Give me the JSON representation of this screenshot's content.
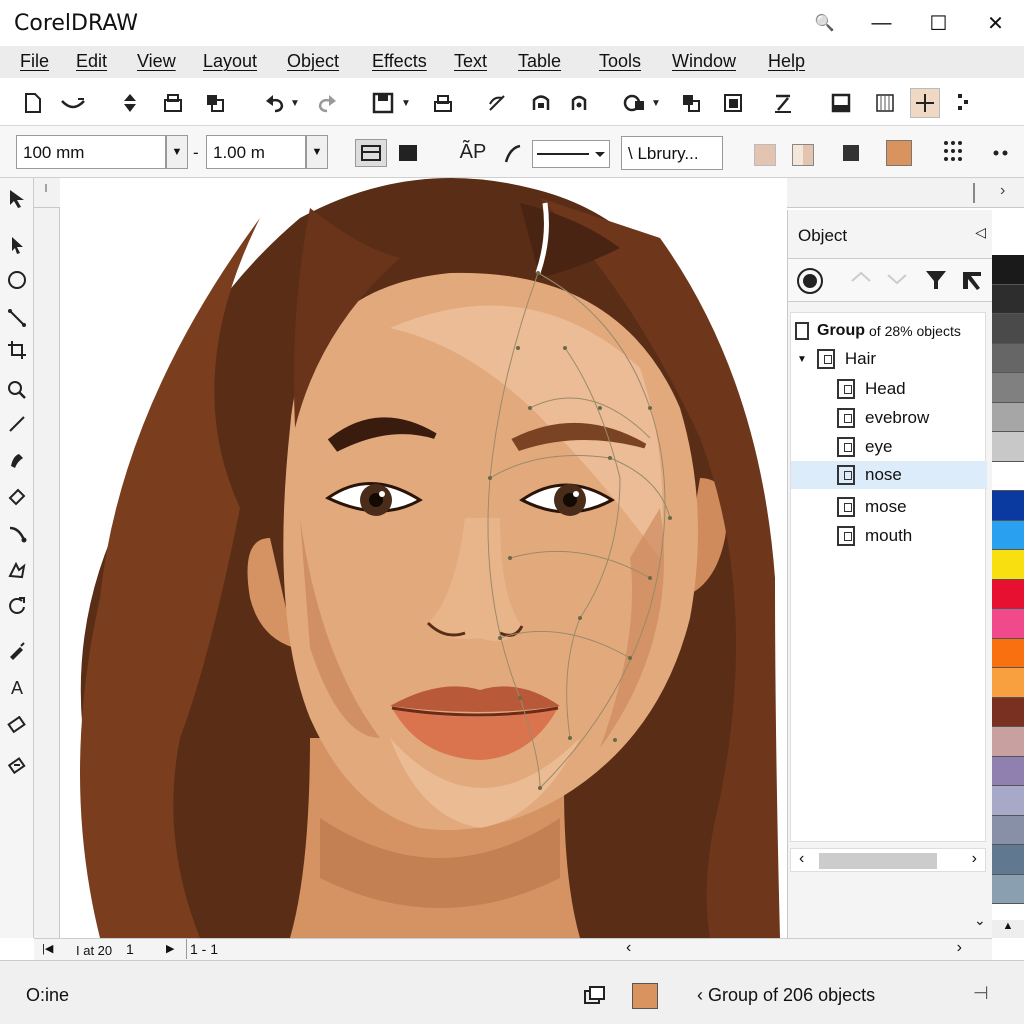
{
  "app": {
    "title": "CorelDRAW"
  },
  "window_controls": {
    "search": "🔍",
    "minimize": "—",
    "maximize": "☐",
    "close": "✕"
  },
  "menu": [
    "File",
    "Edit",
    "View",
    "Layout",
    "Object",
    "Effects",
    "Text",
    "Table",
    "Tools",
    "Window",
    "Help"
  ],
  "property_bar": {
    "width_value": "100 mm",
    "separator": "-",
    "height_value": "1.00 m",
    "library_label": "\\ Lbrury..."
  },
  "docker": {
    "title": "Object",
    "items": [
      {
        "label": "Group",
        "suffix": "of 28% objects",
        "level": 0
      },
      {
        "label": "Hair",
        "level": 1,
        "expanded": true
      },
      {
        "label": "Head",
        "level": 2
      },
      {
        "label": "evebrow",
        "level": 2
      },
      {
        "label": "eye",
        "level": 2
      },
      {
        "label": "nose",
        "level": 2,
        "selected": true
      },
      {
        "label": "mose",
        "level": 2
      },
      {
        "label": "mouth",
        "level": 2
      }
    ]
  },
  "page_nav": {
    "page_info": "I at 20",
    "page_number": "1",
    "page_range": "1 - 1"
  },
  "status": {
    "left_text": "O:ine",
    "selection_text": "Group of 206 objects",
    "fill_color": "#d9935f"
  },
  "colors": {
    "accent_fill": "#d9935f",
    "selected_row": "#dcecfb",
    "palette": [
      "#1a1a1a",
      "#2d2d2d",
      "#4a4a4a",
      "#666666",
      "#808080",
      "#a6a6a6",
      "#c8c8c8",
      "#ffffff",
      "#0a3aa0",
      "#2aa0f0",
      "#f8e010",
      "#e81030",
      "#f04a8c",
      "#f87010",
      "#f8a040",
      "#7a3020",
      "#c8a0a0",
      "#9080b0",
      "#a8a8c8",
      "#8890a8",
      "#607890",
      "#8aa0b0"
    ]
  }
}
